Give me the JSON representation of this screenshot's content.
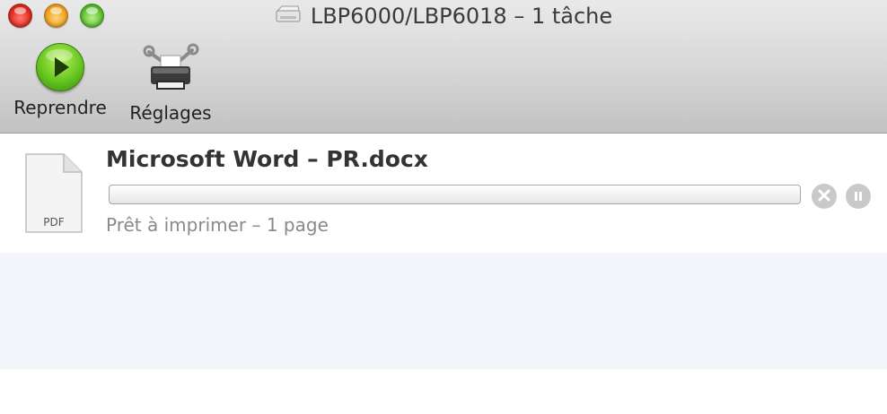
{
  "window": {
    "title": "LBP6000/LBP6018 – 1 tâche"
  },
  "toolbar": {
    "resume_label": "Reprendre",
    "settings_label": "Réglages"
  },
  "job": {
    "name": "Microsoft Word – PR.docx",
    "file_type": "PDF",
    "status": "Prêt à imprimer – 1 page",
    "progress_fraction": 0
  },
  "icons": {
    "close": "close-window-icon",
    "minimize": "minimize-window-icon",
    "zoom": "zoom-window-icon",
    "printer": "printer-icon",
    "resume": "play-icon",
    "settings": "printer-tools-icon",
    "document": "pdf-document-icon",
    "cancel": "cancel-icon",
    "pause": "pause-icon"
  },
  "colors": {
    "toolbar_top": "#e9e9e9",
    "toolbar_bottom": "#c2c2c2",
    "resume_green": "#66c51e",
    "empty_area": "#f2f5f9",
    "control_gray": "#c9c9c9"
  }
}
